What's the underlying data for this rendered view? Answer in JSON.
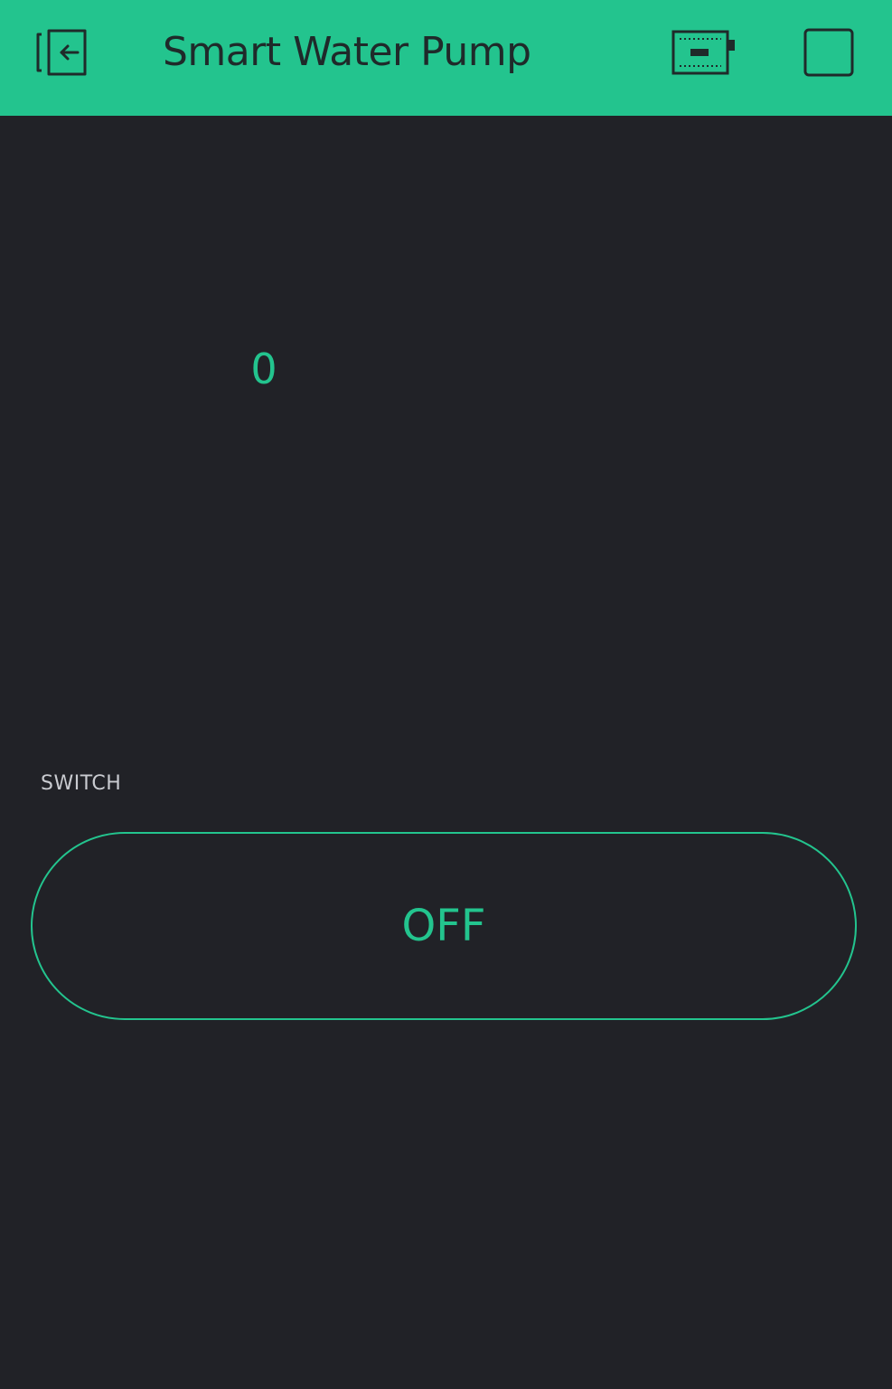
{
  "header": {
    "title": "Smart Water Pump",
    "back_icon": "exit-icon",
    "device_icon": "device-board-icon",
    "play_icon": "play-stop-icon"
  },
  "widgets": {
    "value_display": "0",
    "switch": {
      "label": "SWITCH",
      "state_label": "OFF"
    }
  },
  "colors": {
    "accent": "#23c48e",
    "background": "#212227",
    "header_text": "#1f2a2a",
    "label_text": "#c9cbd0"
  }
}
